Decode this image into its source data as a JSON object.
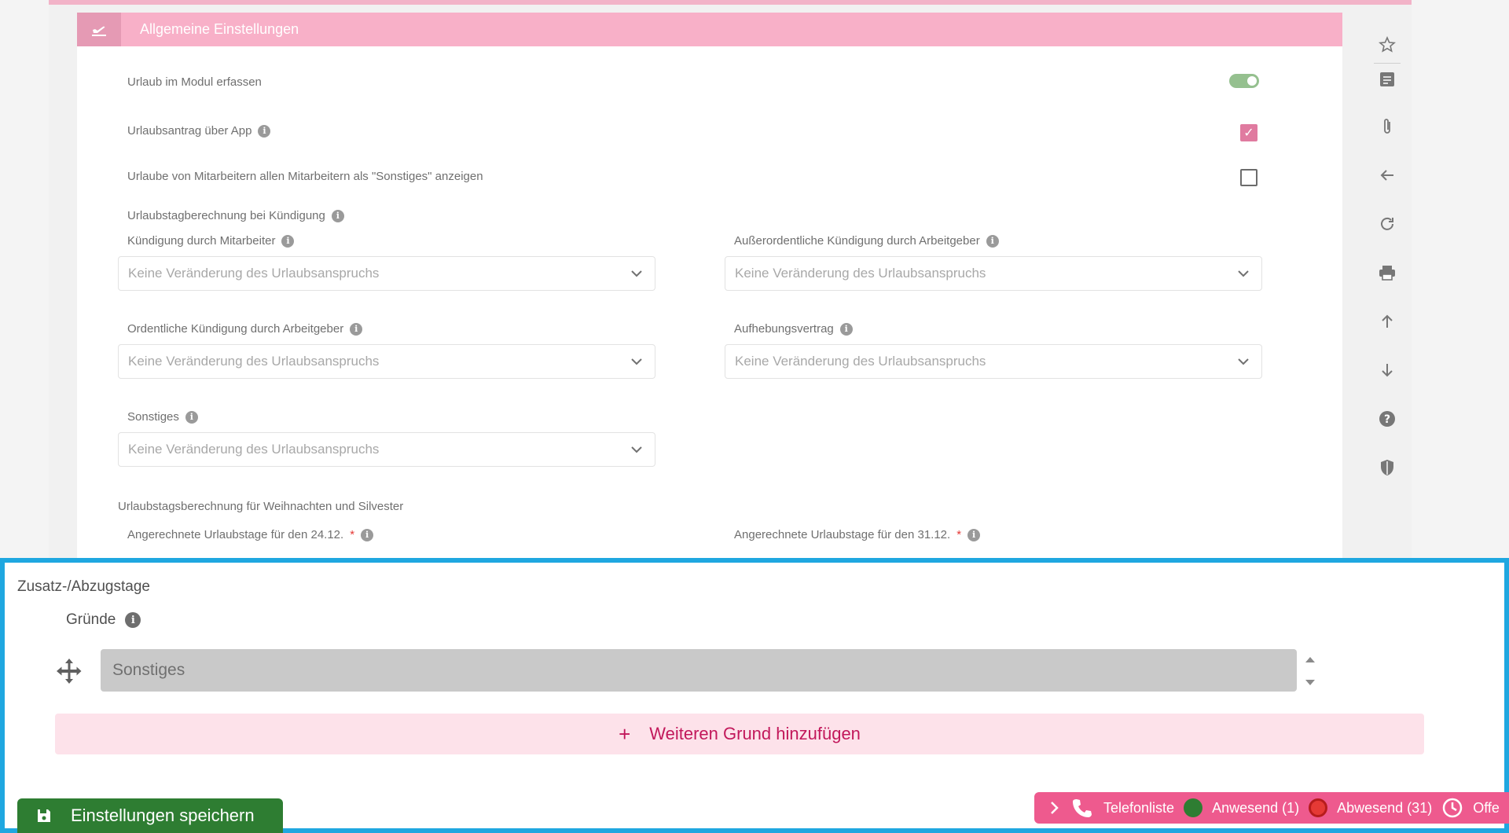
{
  "card": {
    "title": "Allgemeine Einstellungen",
    "rows": {
      "module": "Urlaub im Modul erfassen",
      "app": "Urlaubsantrag über App",
      "others": "Urlaube von Mitarbeitern allen Mitarbeitern als \"Sonstiges\" anzeigen"
    },
    "termination_section": "Urlaubstagberechnung bei Kündigung",
    "fields": {
      "employee": "Kündigung durch Mitarbeiter",
      "extraordinary": "Außerordentliche Kündigung durch Arbeitgeber",
      "ordinary": "Ordentliche Kündigung durch Arbeitgeber",
      "termination_agreement": "Aufhebungsvertrag",
      "other": "Sonstiges"
    },
    "select_value": "Keine Veränderung des Urlaubsanspruchs",
    "christmas_section": "Urlaubstagsberechnung für Weihnachten und Silvester",
    "christmas_fields": {
      "dec24": "Angerechnete Urlaubstage für den 24.12.",
      "dec31": "Angerechnete Urlaubstage für den 31.12.",
      "required_mark": "*"
    },
    "toggle_on": true,
    "app_checked": true,
    "others_checked": false
  },
  "toolbar": [
    "star-icon",
    "document-icon",
    "paperclip-icon",
    "arrow-left-icon",
    "refresh-icon",
    "print-icon",
    "arrow-up-icon",
    "arrow-down-icon",
    "help-icon",
    "shield-icon"
  ],
  "overlay": {
    "title": "Zusatz-/Abzugstage",
    "reasons_label": "Gründe",
    "reason_value": "Sonstiges",
    "add_button": "Weiteren Grund hinzufügen",
    "save_button": "Einstellungen speichern"
  },
  "status_bar": {
    "phone_list": "Telefonliste",
    "present": "Anwesend (1)",
    "absent": "Abwesend (31)",
    "open": "Offe"
  },
  "colors": {
    "accent_pink": "#f8b0c8",
    "status_pink": "#ee5a8e",
    "save_green": "#2e7d32",
    "overlay_border": "#1fa7e0"
  }
}
